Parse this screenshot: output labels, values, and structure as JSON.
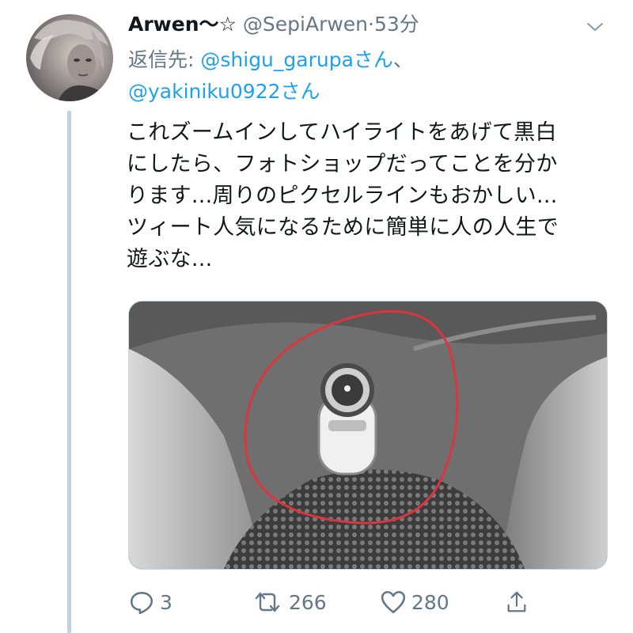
{
  "tweet": {
    "display_name": "Arwen〜☆",
    "handle": "@SepiArwen",
    "separator": "·",
    "time": "53分",
    "reply_prefix": "返信先: ",
    "reply_mentions": [
      "@shigu_garupa",
      "@yakiniku0922"
    ],
    "reply_suffix": "さん",
    "reply_joiner": "、",
    "text_lines": [
      "これズームインしてハイライトをあげて黒白",
      "にしたら、フォトショップだってことを分か",
      "ります...周りのピクセルラインもおかしい...",
      "ツィート人気になるために簡単に人の人生で",
      "遊ぶな..."
    ]
  },
  "actions": {
    "reply": {
      "icon": "reply-icon",
      "count": "3"
    },
    "retweet": {
      "icon": "retweet-icon",
      "count": "266"
    },
    "like": {
      "icon": "heart-icon",
      "count": "280"
    },
    "share": {
      "icon": "share-icon"
    }
  },
  "colors": {
    "link": "#1da1f2",
    "muted": "#657786",
    "text": "#14171a",
    "thread_line": "#c4cfd6",
    "annotation_circle": "#d9363e"
  }
}
